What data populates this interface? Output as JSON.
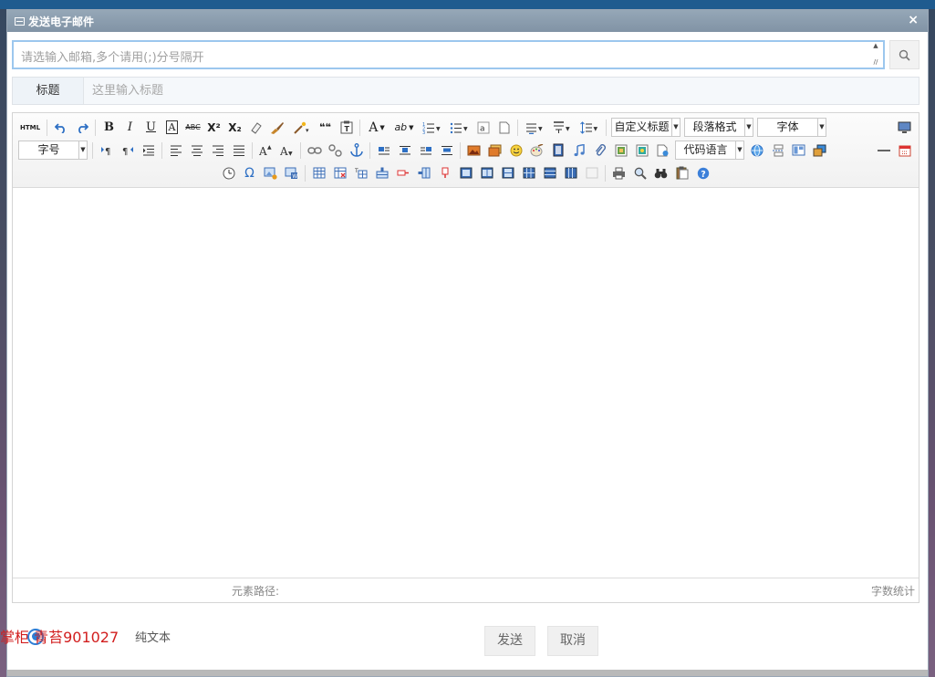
{
  "dialog": {
    "title": "发送电子邮件",
    "close": "×"
  },
  "email": {
    "placeholder": "请选输入邮箱,多个请用(;)分号隔开",
    "scroll_up": "▲",
    "scroll_down": "▼",
    "resize": "//"
  },
  "subject": {
    "label": "标题",
    "placeholder": "这里输入标题"
  },
  "toolbar": {
    "row1": {
      "html": "HTML",
      "bold": "B",
      "italic": "I",
      "underline": "U",
      "border": "A",
      "strike": "ABC",
      "sup": "X²",
      "sub": "X₂",
      "quote": "❝❝",
      "font_color": "A",
      "highlight": "ab",
      "custom_title": "自定义标题",
      "paragraph": "段落格式",
      "font_family": "字体"
    },
    "row2": {
      "font_size": "字号",
      "code_lang": "代码语言"
    },
    "row3": {
      "omega": "Ω"
    }
  },
  "status": {
    "path_label": "元素路径:",
    "word_count": "字数统计"
  },
  "format": {
    "watermark": "掌柜 青苔901027",
    "plain_text": "纯文本"
  },
  "actions": {
    "send": "发送",
    "cancel": "取消"
  }
}
